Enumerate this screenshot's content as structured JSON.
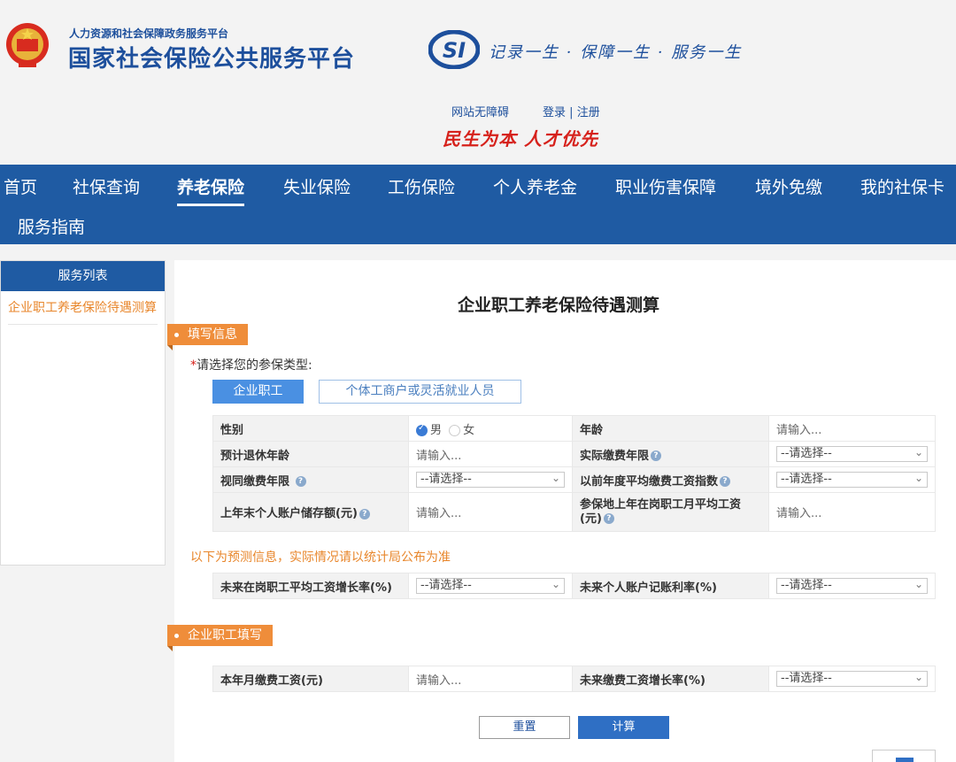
{
  "header": {
    "ministry": "人力资源和社会保障政务服务平台",
    "site_name": "国家社会保险公共服务平台",
    "slogan": "记录一生 · 保障一生 · 服务一生",
    "accessibility_link": "网站无障碍",
    "login": "登录",
    "separator": "|",
    "register": "注册",
    "red_slogan": "民生为本 人才优先"
  },
  "nav": {
    "items": [
      "首页",
      "社保查询",
      "养老保险",
      "失业保险",
      "工伤保险",
      "个人养老金",
      "职业伤害保障",
      "境外免缴",
      "我的社保卡",
      "服务指南"
    ],
    "active": "养老保险"
  },
  "sidebar": {
    "title": "服务列表",
    "link": "企业职工养老保险待遇测算"
  },
  "main": {
    "title": "企业职工养老保险待遇测算",
    "section1": "填写信息",
    "required_star": "*",
    "type_prompt": "请选择您的参保类型:",
    "type_options": [
      "企业职工",
      "个体工商户或灵活就业人员"
    ],
    "fields": {
      "gender_label": "性别",
      "gender_male": "男",
      "gender_female": "女",
      "age_label": "年龄",
      "age_placeholder": "请输入...",
      "retire_age_label": "预计退休年龄",
      "retire_age_placeholder": "请输入...",
      "actual_years_label": "实际缴费年限",
      "actual_years_value": "--请选择--",
      "deemed_years_label": "视同缴费年限",
      "deemed_years_value": "--请选择--",
      "avg_index_label": "以前年度平均缴费工资指数",
      "avg_index_value": "--请选择--",
      "account_balance_label": "上年末个人账户储存额(元)",
      "account_balance_placeholder": "请输入...",
      "avg_wage_label": "参保地上年在岗职工月平均工资(元)",
      "avg_wage_placeholder": "请输入..."
    },
    "notice": "以下为预测信息，实际情况请以统计局公布为准",
    "forecast": {
      "wage_growth_label": "未来在岗职工平均工资增长率(%)",
      "wage_growth_value": "--请选择--",
      "interest_label": "未来个人账户记账利率(%)",
      "interest_value": "--请选择--"
    },
    "section2": "企业职工填写",
    "employee": {
      "monthly_wage_label": "本年月缴费工资(元)",
      "monthly_wage_placeholder": "请输入...",
      "future_growth_label": "未来缴费工资增长率(%)",
      "future_growth_value": "--请选择--"
    },
    "reset_label": "重置",
    "calc_label": "计算"
  },
  "colors": {
    "brand_blue": "#1f5ba3",
    "accent_orange": "#ef8d3a",
    "slogan_red": "#d6211b"
  }
}
